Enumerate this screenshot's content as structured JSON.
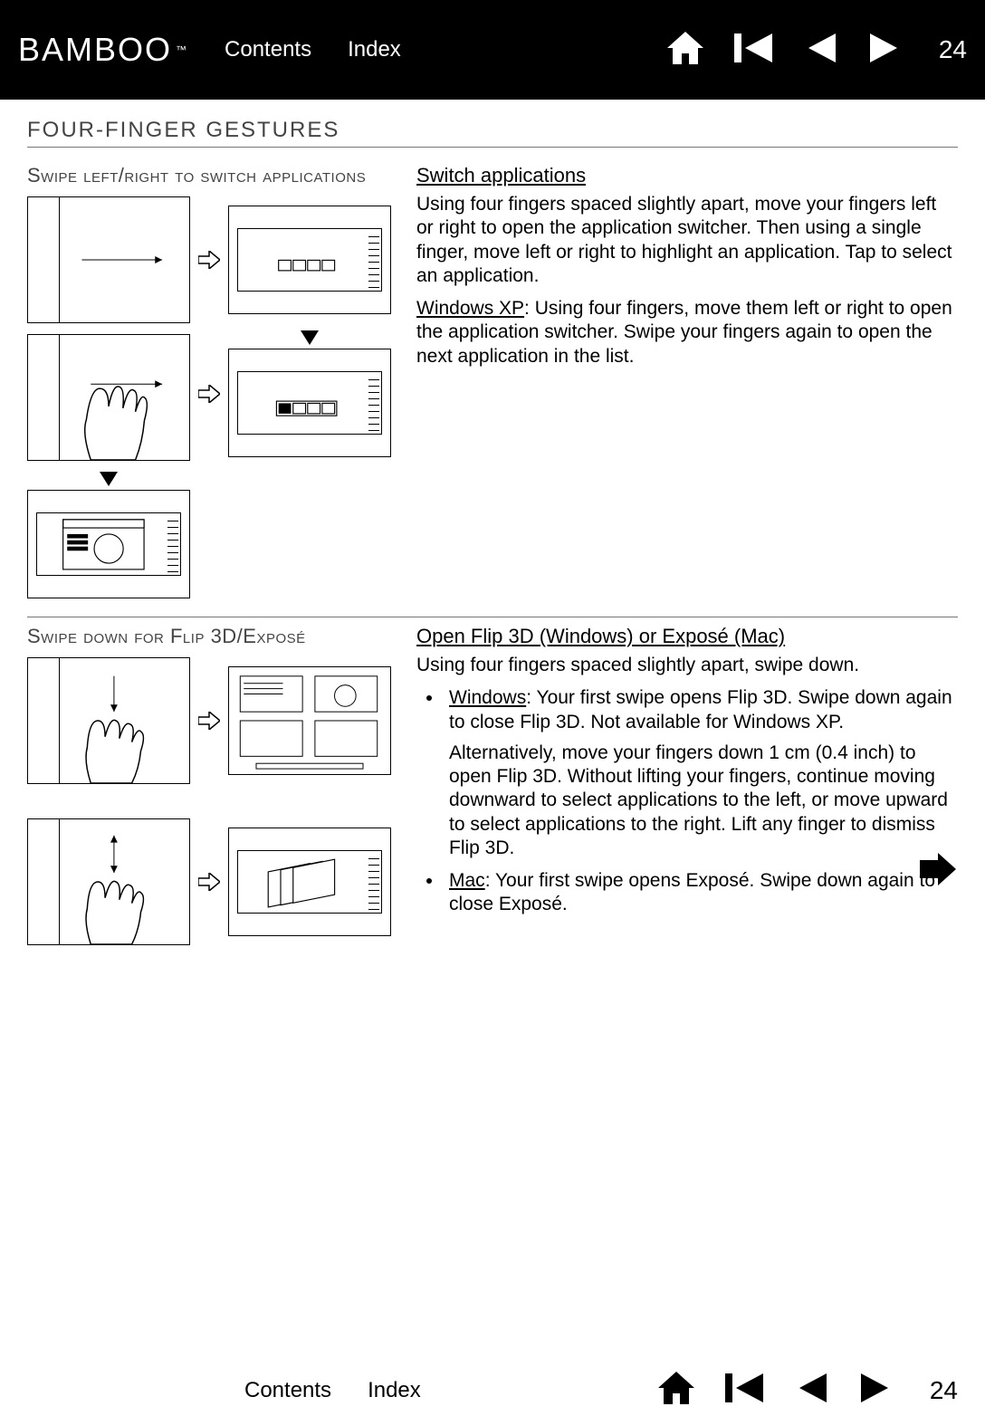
{
  "nav": {
    "brand": "BAMBOO",
    "tm": "™",
    "contents": "Contents",
    "index": "Index",
    "page": "24"
  },
  "section_title": "FOUR-FINGER GESTURES",
  "g1": {
    "label": "Swipe left/right to switch applications",
    "action": "Switch applications",
    "p1": "Using four fingers spaced slightly apart, move your fingers left or right to open the application switcher.  Then using a single finger, move left or right to highlight an application.  Tap to select an application.",
    "xp_label": "Windows XP",
    "p2": ": Using four fingers, move them left or right to open the application switcher.  Swipe your fingers again to open the next application in the list."
  },
  "g2": {
    "label": "Swipe down for Flip 3D/Exposé",
    "action": "Open Flip 3D (Windows) or Exposé (Mac)",
    "p1": "Using four fingers spaced slightly apart, swipe down.",
    "win_label": "Windows",
    "win_text1": ": Your first swipe opens Flip 3D.  Swipe down again to close Flip 3D.  Not available for Windows XP.",
    "win_text2": "Alternatively, move your fingers down 1 cm (0.4 inch) to open Flip 3D.  Without lifting your fingers, continue moving downward to select applications to the left, or move upward to select applications to the right.  Lift any finger to dismiss Flip 3D.",
    "mac_label": "Mac",
    "mac_text": ": Your first swipe opens Exposé.  Swipe down again to close Exposé."
  },
  "footer": {
    "contents": "Contents",
    "index": "Index",
    "page": "24"
  }
}
